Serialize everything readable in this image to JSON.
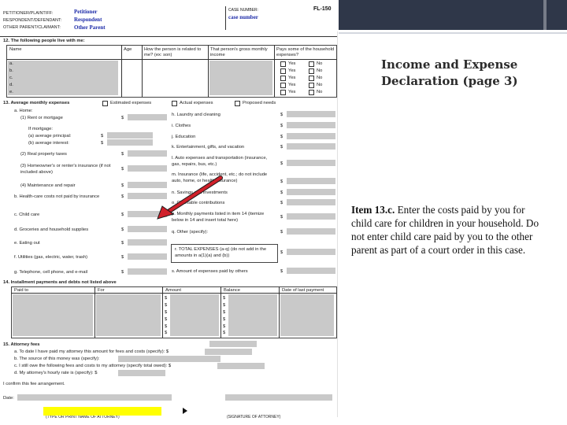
{
  "slide": {
    "title": "Income and Expense Declaration (page 3)",
    "instruction_lead": "Item 13.c.",
    "instruction_body": "Enter the costs paid by you for child care for children in your household.  Do not enter child care paid by you to the other parent as part of a court order in this case.",
    "colors": {
      "header_bar": "#2f3749",
      "highlight": "#ffff00",
      "arrow": "#d0202a",
      "redacted": "#c9c9c9",
      "filled_text": "#1c2aa8"
    }
  },
  "form": {
    "code": "FL-150",
    "header": {
      "petitioner_label": "PETITIONER/PLAINTIFF:",
      "respondent_label": "RESPONDENT/DEFENDANT:",
      "other_label": "OTHER PARENT/CLAIMANT:",
      "petitioner_value": "Petitioner",
      "respondent_value": "Respondent",
      "other_value": "Other Parent",
      "case_label": "CASE NUMBER:",
      "case_value": "case number"
    },
    "item12": {
      "title": "12. The following people live with me:",
      "cols": [
        "Name",
        "Age",
        "How the person is related to me? (ex: son)",
        "That person's gross monthly income",
        "Pays some of the household expenses?"
      ],
      "rows": [
        "a.",
        "b.",
        "c.",
        "d.",
        "e."
      ],
      "yes": "Yes",
      "no": "No"
    },
    "item13": {
      "title": "13. Average monthly expenses",
      "estimated": "Estimated expenses",
      "actual": "Actual expenses",
      "proposed": "Proposed needs",
      "left": [
        "a. Home:",
        "(1) Rent or mortgage",
        "If mortgage:",
        "(a) average principal:",
        "(b) average interest:",
        "(2) Real property taxes",
        "(3) Homeowner's or renter's insurance (if not included above)",
        "(4) Maintenance and repair",
        "b. Health-care costs not paid by insurance",
        "c. Child care",
        "d. Groceries and household supplies",
        "e. Eating out",
        "f. Utilities (gas, electric, water, trash)",
        "g. Telephone, cell phone, and e-mail"
      ],
      "right": [
        "h. Laundry and cleaning",
        "i. Clothes",
        "j. Education",
        "k. Entertainment, gifts, and vacation",
        "l. Auto expenses and transportation (insurance, gas, repairs, bus, etc.)",
        "m. Insurance (life, accident, etc.; do not include auto, home, or health insurance)",
        "n. Savings and investments",
        "o. Charitable contributions",
        "p. Monthly payments listed in item 14 (itemize below in 14 and insert total here)",
        "q. Other (specify):",
        "r. TOTAL EXPENSES (a-q) (do not add in the amounts in a(1)(a) and (b))",
        "s. Amount of expenses paid by others"
      ],
      "currency": "$"
    },
    "item14": {
      "title": "14. Installment payments and debts not listed above",
      "cols": [
        "Paid to",
        "For",
        "Amount",
        "Balance",
        "Date of last payment"
      ],
      "currency": "$"
    },
    "item15": {
      "title": "15. Attorney fees",
      "lines": [
        "a. To date I have paid my attorney this amount for fees and costs (specify): $",
        "b. The source of this money was (specify):",
        "c. I still owe the following fees and costs to my attorney (specify total owed): $",
        "d. My attorney's hourly rate is (specify): $"
      ]
    },
    "confirm": "I confirm this fee arrangement.",
    "date_label": "Date:",
    "sig_left": "(TYPE OR PRINT NAME OF ATTORNEY)",
    "sig_right": "(SIGNATURE OF ATTORNEY)"
  }
}
